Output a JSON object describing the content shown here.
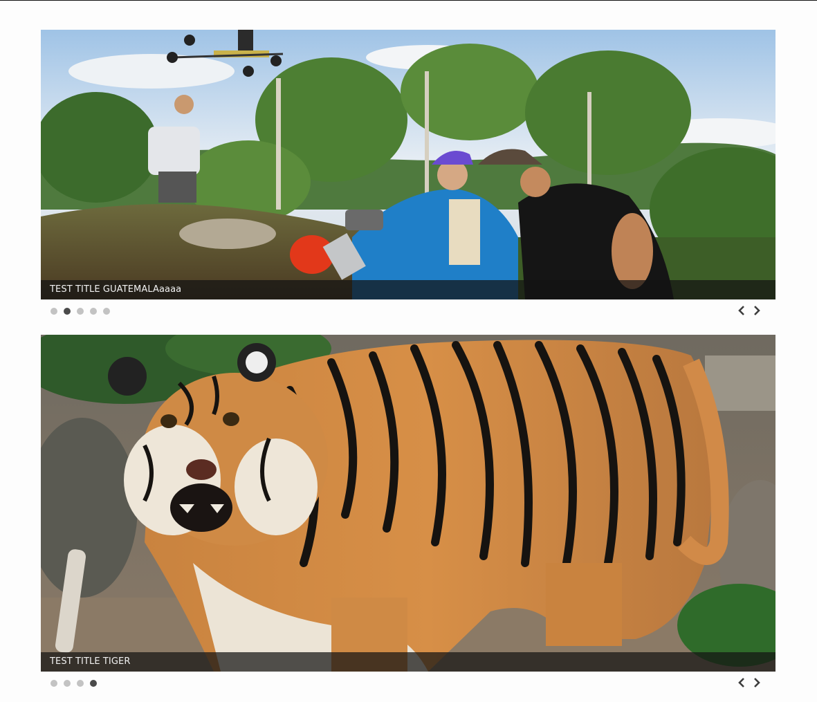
{
  "sliders": [
    {
      "caption": "TEST TITLE GUATEMALAaaaa",
      "slide_count": 5,
      "active_index": 1
    },
    {
      "caption": "TEST TITLE TIGER",
      "slide_count": 4,
      "active_index": 3
    }
  ],
  "icons": {
    "prev": "chevron-left-icon",
    "next": "chevron-right-icon"
  },
  "colors": {
    "caption_bg": "#141414",
    "dot_inactive": "#c3c3c3",
    "dot_active": "#4a4a4a"
  }
}
